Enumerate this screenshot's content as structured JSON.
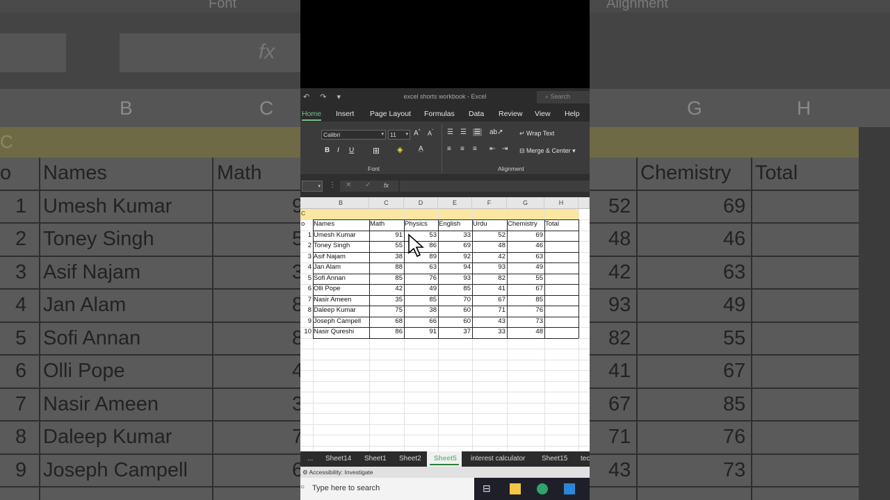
{
  "background": {
    "ribbon_labels": [
      "Font",
      "Alignment"
    ],
    "fx": "fx",
    "col_letters": [
      "B",
      "C",
      "G",
      "H"
    ],
    "yellow_text": "C",
    "headers": [
      "o",
      "Names",
      "Math",
      "Chemistry",
      "Total"
    ],
    "rows": [
      {
        "no": "1",
        "name": "Umesh Kumar",
        "math": "9",
        "p": "52",
        "chem": "69"
      },
      {
        "no": "2",
        "name": "Toney Singh",
        "math": "5",
        "p": "48",
        "chem": "46"
      },
      {
        "no": "3",
        "name": "Asif Najam",
        "math": "3",
        "p": "42",
        "chem": "63"
      },
      {
        "no": "4",
        "name": "Jan Alam",
        "math": "8",
        "p": "93",
        "chem": "49"
      },
      {
        "no": "5",
        "name": "Sofi Annan",
        "math": "8",
        "p": "82",
        "chem": "55"
      },
      {
        "no": "6",
        "name": "Olli Pope",
        "math": "4",
        "p": "41",
        "chem": "67"
      },
      {
        "no": "7",
        "name": "Nasir Ameen",
        "math": "3",
        "p": "67",
        "chem": "85"
      },
      {
        "no": "8",
        "name": "Daleep Kumar",
        "math": "7",
        "p": "71",
        "chem": "76"
      },
      {
        "no": "9",
        "name": "Joseph Campell",
        "math": "6",
        "p": "43",
        "chem": "73"
      }
    ]
  },
  "window": {
    "title": "excel shorts workbook  -  Excel",
    "search": "Search",
    "tabs": [
      "Home",
      "Insert",
      "Page Layout",
      "Formulas",
      "Data",
      "Review",
      "View",
      "Help"
    ],
    "font_name": "Calibri",
    "font_size": "11",
    "bold": "B",
    "italic": "I",
    "underline": "U",
    "wrap_text": "Wrap Text",
    "merge_center": "Merge & Center",
    "group_font": "Font",
    "group_alignment": "Alignment",
    "fx_label": "fx",
    "cancel": "✕",
    "enter": "✓"
  },
  "sheet": {
    "columns": [
      "B",
      "C",
      "D",
      "E",
      "F",
      "G",
      "H"
    ],
    "yellow_text": "C",
    "headers": [
      "o",
      "Names",
      "Math",
      "Physics",
      "English",
      "Urdu",
      "Chemistry",
      "Total"
    ],
    "rows": [
      [
        "1",
        "Umesh Kumar",
        "91",
        "53",
        "33",
        "52",
        "69"
      ],
      [
        "2",
        "Toney Singh",
        "55",
        "86",
        "69",
        "48",
        "46"
      ],
      [
        "3",
        "Asif Najam",
        "38",
        "89",
        "92",
        "42",
        "63"
      ],
      [
        "4",
        "Jan Alam",
        "88",
        "63",
        "94",
        "93",
        "49"
      ],
      [
        "5",
        "Sofi Annan",
        "85",
        "76",
        "93",
        "82",
        "55"
      ],
      [
        "6",
        "Olli Pope",
        "42",
        "49",
        "85",
        "41",
        "67"
      ],
      [
        "7",
        "Nasir Ameen",
        "35",
        "85",
        "70",
        "67",
        "85"
      ],
      [
        "8",
        "Daleep Kumar",
        "75",
        "38",
        "60",
        "71",
        "76"
      ],
      [
        "9",
        "Joseph Campell",
        "68",
        "66",
        "60",
        "43",
        "73"
      ],
      [
        "10",
        "Nasir Qureshi",
        "86",
        "91",
        "37",
        "33",
        "48"
      ]
    ]
  },
  "sheet_tabs": [
    "...",
    "Sheet14",
    "Sheet1",
    "Sheet2",
    "Sheet5",
    "interest calculator",
    "Sheet15",
    "tec"
  ],
  "active_sheet": "Sheet5",
  "status": "Accessibility: Investigate",
  "taskbar": {
    "search_placeholder": "Type here to search"
  }
}
